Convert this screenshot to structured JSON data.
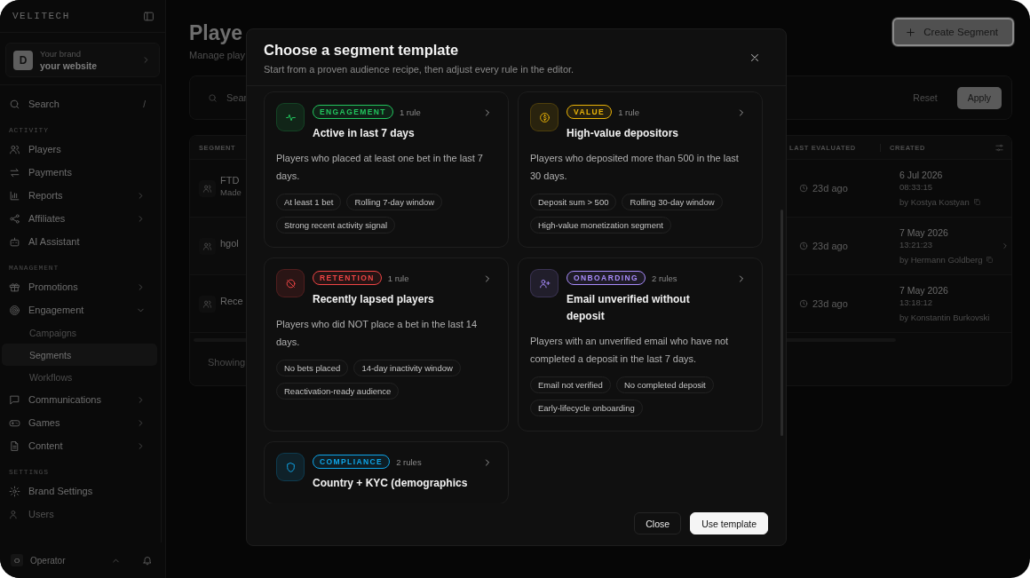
{
  "sidebar": {
    "logo": "VELITECH",
    "brand": {
      "avatar": "D",
      "label": "Your brand",
      "name": "your website"
    },
    "search": {
      "label": "Search",
      "shortcut": "/"
    },
    "sections": [
      {
        "title": "ACTIVITY",
        "items": [
          {
            "label": "Players",
            "kind": "link"
          },
          {
            "label": "Payments",
            "kind": "link"
          },
          {
            "label": "Reports",
            "kind": "group",
            "expanded": false
          },
          {
            "label": "Affiliates",
            "kind": "group",
            "expanded": false
          },
          {
            "label": "AI Assistant",
            "kind": "link"
          }
        ]
      },
      {
        "title": "MANAGEMENT",
        "items": [
          {
            "label": "Promotions",
            "kind": "group",
            "expanded": false
          },
          {
            "label": "Engagement",
            "kind": "group",
            "expanded": true,
            "children": [
              {
                "label": "Campaigns",
                "selected": false
              },
              {
                "label": "Segments",
                "selected": true
              },
              {
                "label": "Workflows",
                "selected": false
              }
            ]
          },
          {
            "label": "Communications",
            "kind": "group",
            "expanded": false
          },
          {
            "label": "Games",
            "kind": "group",
            "expanded": false
          },
          {
            "label": "Content",
            "kind": "group",
            "expanded": false
          }
        ]
      },
      {
        "title": "SETTINGS",
        "items": [
          {
            "label": "Brand Settings",
            "kind": "link"
          },
          {
            "label": "Users",
            "kind": "link"
          }
        ]
      }
    ],
    "footer": {
      "avatar": "O",
      "name": "Operator"
    }
  },
  "main": {
    "title": "Playe",
    "subtitle": "Manage play",
    "create_button": "Create Segment",
    "filters": {
      "search_placeholder": "Sear",
      "reset": "Reset",
      "apply": "Apply"
    },
    "table": {
      "columns": [
        "SEGMENT",
        "LAST EVALUATED",
        "CREATED"
      ],
      "rows": [
        {
          "name": "FTD",
          "note": "Made",
          "last_evaluated": "23d ago",
          "created_date": "6 Jul 2026",
          "created_time": "08:33:15",
          "created_by": "by Kostya Kostyan",
          "copy": true,
          "hovered": false
        },
        {
          "name": "hgol",
          "last_evaluated": "23d ago",
          "created_date": "7 May 2026",
          "created_time": "13:21:23",
          "created_by": "by Hermann Goldberg",
          "copy": true,
          "hovered": true
        },
        {
          "name": "Rece",
          "last_evaluated": "23d ago",
          "created_date": "7 May 2026",
          "created_time": "13:18:12",
          "created_by": "by Konstantin Burkovski",
          "copy": false,
          "hovered": false
        }
      ],
      "footer": "Showing"
    }
  },
  "modal": {
    "title": "Choose a segment template",
    "subtitle": "Start from a proven audience recipe, then adjust every rule in the editor.",
    "templates": [
      {
        "category": "ENGAGEMENT",
        "color": "#22c55e",
        "rules": "1 rule",
        "title": "Active in last 7 days",
        "description": "Players who placed at least one bet in the last 7 days.",
        "chips": [
          "At least 1 bet",
          "Rolling 7-day window",
          "Strong recent activity signal"
        ]
      },
      {
        "category": "VALUE",
        "color": "#eab308",
        "rules": "1 rule",
        "title": "High-value depositors",
        "description": "Players who deposited more than 500 in the last 30 days.",
        "chips": [
          "Deposit sum > 500",
          "Rolling 30-day window",
          "High-value monetization segment"
        ]
      },
      {
        "category": "RETENTION",
        "color": "#ef4444",
        "rules": "1 rule",
        "title": "Recently lapsed players",
        "description": "Players who did NOT place a bet in the last 14 days.",
        "chips": [
          "No bets placed",
          "14-day inactivity window",
          "Reactivation-ready audience"
        ]
      },
      {
        "category": "ONBOARDING",
        "color": "#a78bfa",
        "rules": "2 rules",
        "title": "Email unverified without deposit",
        "description": "Players with an unverified email who have not completed a deposit in the last 7 days.",
        "chips": [
          "Email not verified",
          "No completed deposit",
          "Early-lifecycle onboarding"
        ]
      },
      {
        "category": "COMPLIANCE",
        "color": "#0ea5e9",
        "rules": "2 rules",
        "title": "Country + KYC (demographics"
      }
    ],
    "buttons": [
      {
        "label": "Close",
        "kind": "secondary"
      },
      {
        "label": "Use template",
        "kind": "primary"
      }
    ]
  }
}
